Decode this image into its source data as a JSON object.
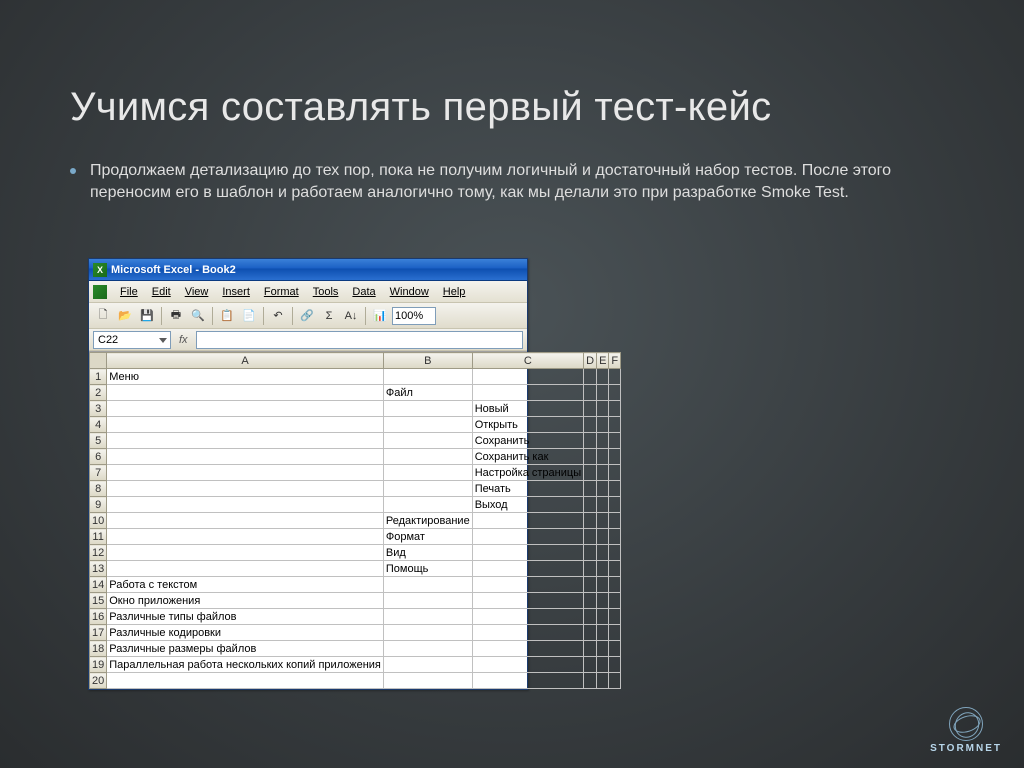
{
  "slide": {
    "title": "Учимся составлять первый тест-кейс",
    "body": "Продолжаем детализацию до тех пор, пока не получим логичный и достаточный набор тестов. После этого переносим его в шаблон и работаем аналогично тому, как мы делали это при разработке Smoke Test."
  },
  "excel": {
    "title": "Microsoft Excel - Book2",
    "menus": [
      "File",
      "Edit",
      "View",
      "Insert",
      "Format",
      "Tools",
      "Data",
      "Window",
      "Help"
    ],
    "zoom": "100%",
    "nameBox": "C22",
    "fx": "fx",
    "columns": [
      "A",
      "B",
      "C",
      "D",
      "E",
      "F"
    ],
    "rows": [
      {
        "n": "1",
        "A": "Меню",
        "B": "",
        "C": ""
      },
      {
        "n": "2",
        "A": "",
        "B": "Файл",
        "C": ""
      },
      {
        "n": "3",
        "A": "",
        "B": "",
        "C": "Новый"
      },
      {
        "n": "4",
        "A": "",
        "B": "",
        "C": "Открыть"
      },
      {
        "n": "5",
        "A": "",
        "B": "",
        "C": "Сохранить"
      },
      {
        "n": "6",
        "A": "",
        "B": "",
        "C": "Сохранить как"
      },
      {
        "n": "7",
        "A": "",
        "B": "",
        "C": "Настройка страницы"
      },
      {
        "n": "8",
        "A": "",
        "B": "",
        "C": "Печать"
      },
      {
        "n": "9",
        "A": "",
        "B": "",
        "C": "Выход"
      },
      {
        "n": "10",
        "A": "",
        "B": "Редактирование",
        "C": ""
      },
      {
        "n": "11",
        "A": "",
        "B": "Формат",
        "C": ""
      },
      {
        "n": "12",
        "A": "",
        "B": "Вид",
        "C": ""
      },
      {
        "n": "13",
        "A": "",
        "B": "Помощь",
        "C": ""
      },
      {
        "n": "14",
        "A": "Работа с текстом",
        "B": "",
        "C": ""
      },
      {
        "n": "15",
        "A": "Окно приложения",
        "B": "",
        "C": ""
      },
      {
        "n": "16",
        "A": "Различные типы файлов",
        "B": "",
        "C": ""
      },
      {
        "n": "17",
        "A": "Различные кодировки",
        "B": "",
        "C": ""
      },
      {
        "n": "18",
        "A": "Различные размеры файлов",
        "B": "",
        "C": ""
      },
      {
        "n": "19",
        "A": "Параллельная работа нескольких копий приложения",
        "B": "",
        "C": ""
      },
      {
        "n": "20",
        "A": "",
        "B": "",
        "C": ""
      }
    ]
  },
  "logo": "STORMNET"
}
